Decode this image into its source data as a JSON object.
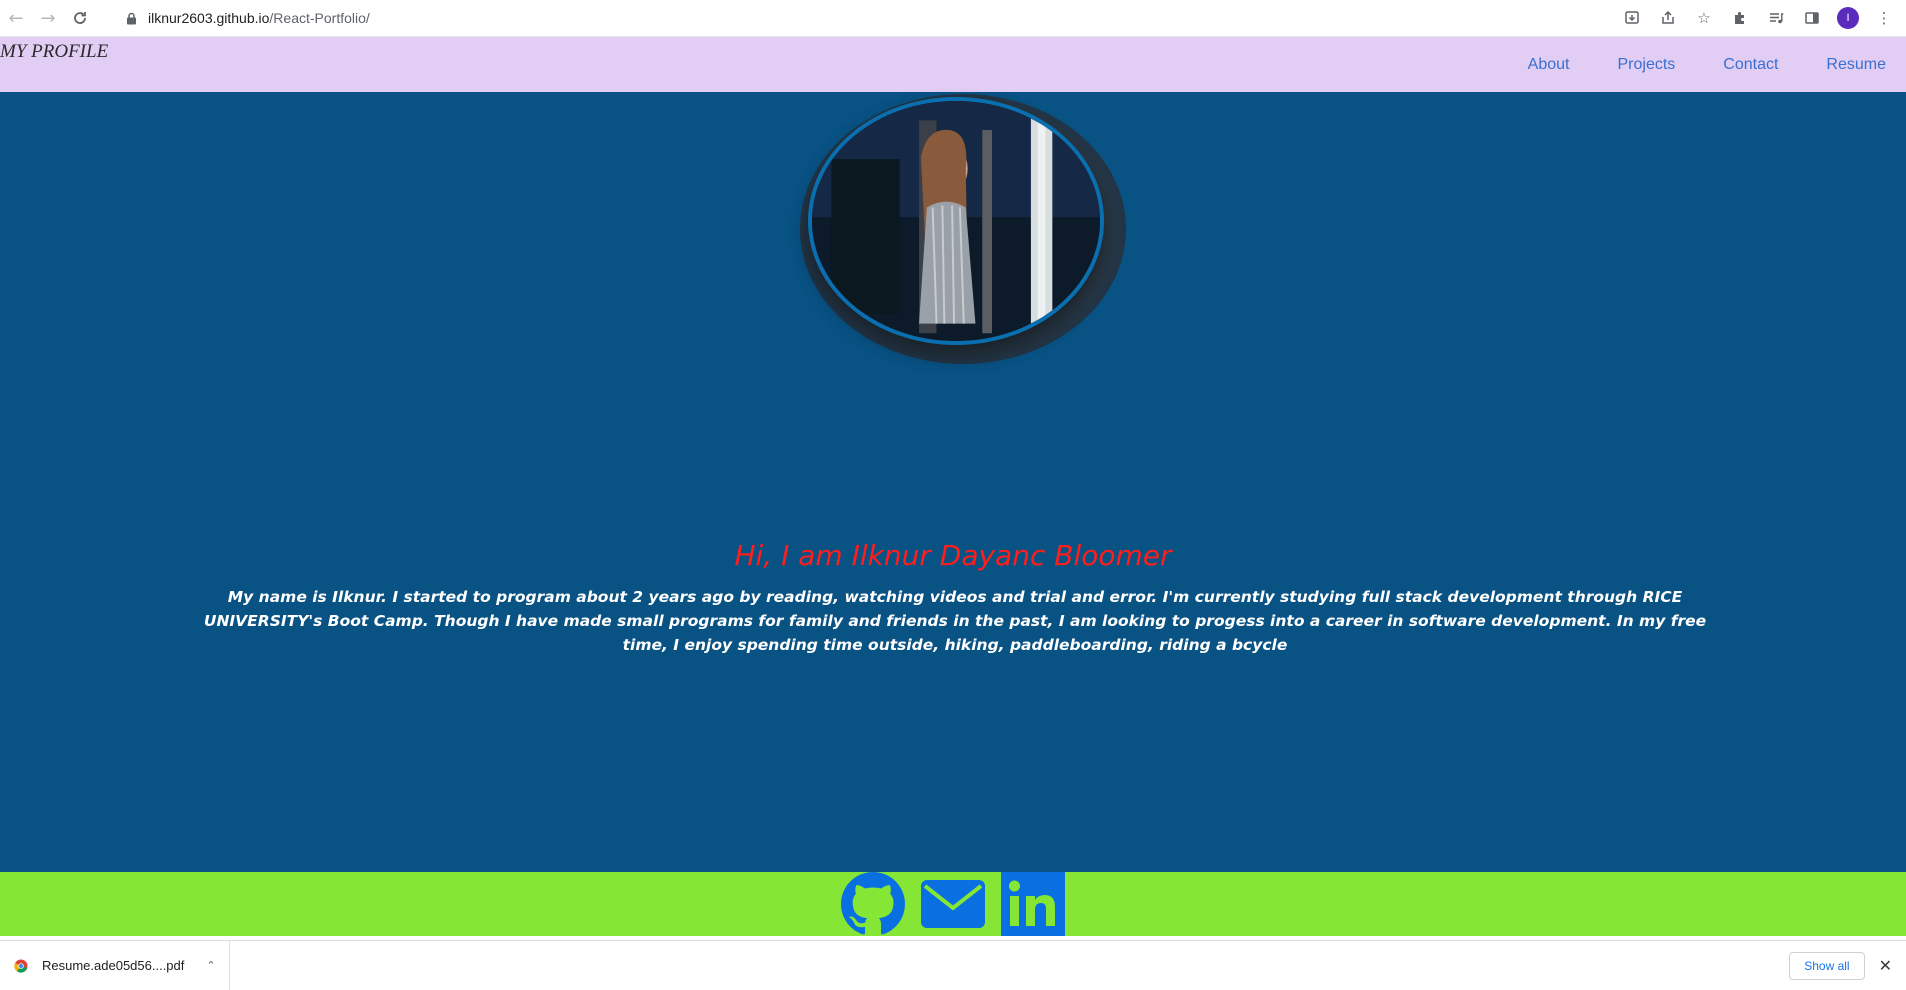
{
  "browser": {
    "url_host": "ilknur2603.github.io",
    "url_path": "/React-Portfolio/",
    "back_icon": "arrow-left-icon",
    "forward_icon": "arrow-right-icon",
    "reload_icon": "reload-icon",
    "profile_initial": "I"
  },
  "header": {
    "brand": "MY PROFILE",
    "nav": [
      {
        "label": "About"
      },
      {
        "label": "Projects"
      },
      {
        "label": "Contact"
      },
      {
        "label": "Resume"
      }
    ],
    "background": "#e2cef4",
    "link_color": "#3a6fd0"
  },
  "hero": {
    "greeting": "Hi, I am Ilknur Dayanc Bloomer",
    "bio": "My name is Ilknur. I started to program about 2 years ago by reading, watching videos and trial and error. I'm currently studying full stack development through RICE UNIVERSITY's Boot Camp. Though I have made small programs for family and friends in the past, I am looking to progess into a career in software development. In my free time, I enjoy spending time outside, hiking, paddleboarding, riding a bcycle",
    "background": "#085284",
    "greeting_color": "#ff1d1d"
  },
  "footer": {
    "background": "#85e636",
    "icon_color": "#0a6fe0",
    "links": [
      {
        "icon": "github-icon"
      },
      {
        "icon": "email-icon"
      },
      {
        "icon": "linkedin-icon"
      }
    ]
  },
  "downloads": {
    "file_name": "Resume.ade05d56....pdf",
    "show_all": "Show all"
  }
}
